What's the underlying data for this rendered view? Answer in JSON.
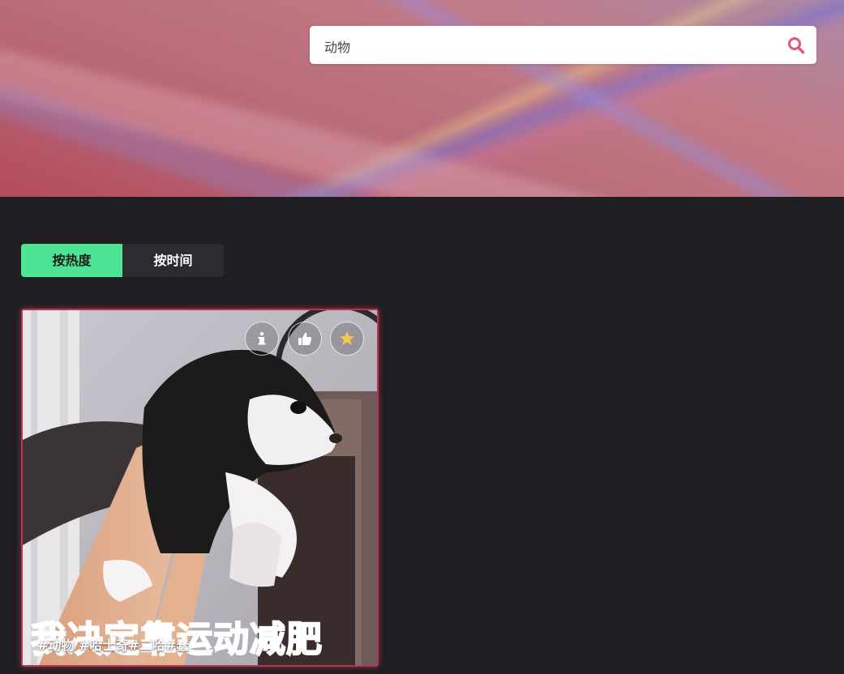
{
  "search": {
    "value": "动物",
    "icon": "search-icon",
    "icon_color": "#e8557a"
  },
  "sort_tabs": [
    {
      "label": "按热度",
      "active": true
    },
    {
      "label": "按时间",
      "active": false
    }
  ],
  "colors": {
    "page_bg": "#1f1e23",
    "active_tab": "#4de594",
    "card_border": "#b2394f"
  },
  "cards": [
    {
      "image_subject": "husky-puppy-gif",
      "caption_in_image": "我决定靠运动减肥",
      "tags": "#动物 #哈士奇#二哈#蠢",
      "actions": [
        {
          "icon": "info-icon"
        },
        {
          "icon": "thumbs-up-icon"
        },
        {
          "icon": "star-icon",
          "color": "#f2c94c"
        }
      ]
    }
  ]
}
